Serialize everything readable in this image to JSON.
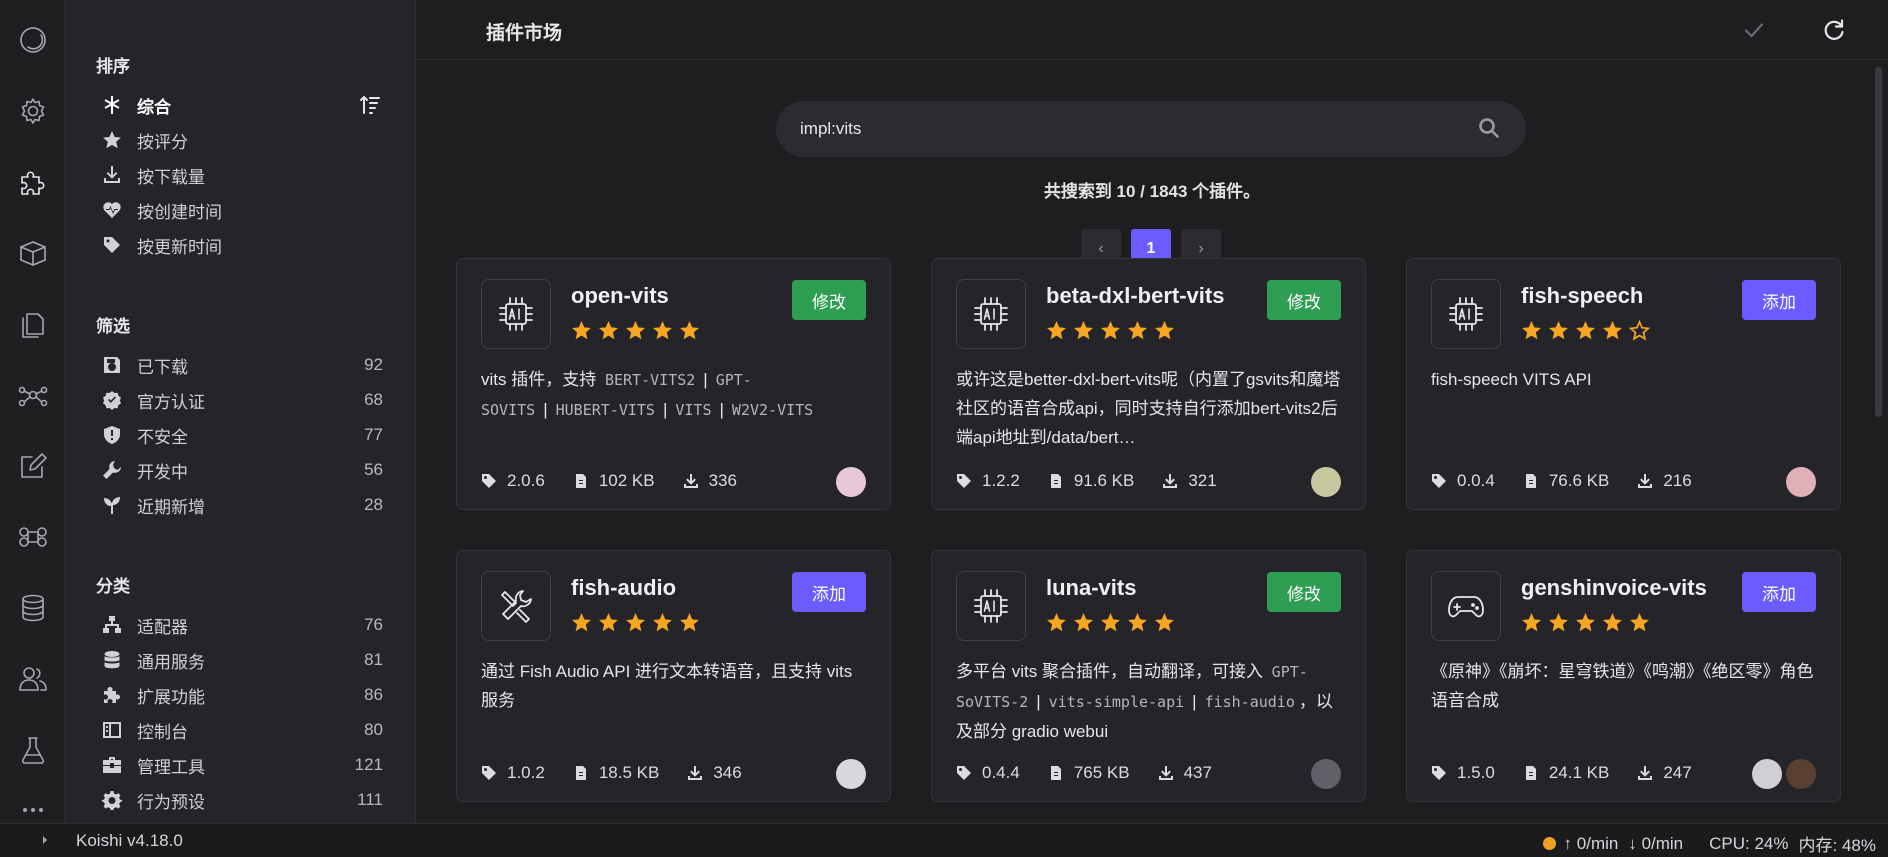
{
  "header": {
    "title": "插件市场"
  },
  "search": {
    "query": "impl:vits"
  },
  "results": {
    "summary": "共搜索到 10 / 1843 个插件。"
  },
  "pagination": {
    "prev": "‹",
    "current": "1",
    "next": "›"
  },
  "sidebar": {
    "sort_title": "排序",
    "sort": [
      {
        "label": "综合",
        "icon": "asterisk-icon",
        "active": true
      },
      {
        "label": "按评分",
        "icon": "star-icon"
      },
      {
        "label": "按下载量",
        "icon": "download-icon"
      },
      {
        "label": "按创建时间",
        "icon": "heartbeat-icon"
      },
      {
        "label": "按更新时间",
        "icon": "tag-icon"
      }
    ],
    "filter_title": "筛选",
    "filters": [
      {
        "label": "已下载",
        "count": "92",
        "icon": "save-icon"
      },
      {
        "label": "官方认证",
        "count": "68",
        "icon": "verified-icon"
      },
      {
        "label": "不安全",
        "count": "77",
        "icon": "shield-warning-icon"
      },
      {
        "label": "开发中",
        "count": "56",
        "icon": "wrench-icon"
      },
      {
        "label": "近期新增",
        "count": "28",
        "icon": "sprout-icon"
      }
    ],
    "category_title": "分类",
    "categories": [
      {
        "label": "适配器",
        "count": "76",
        "icon": "sitemap-icon"
      },
      {
        "label": "通用服务",
        "count": "81",
        "icon": "database-icon"
      },
      {
        "label": "扩展功能",
        "count": "86",
        "icon": "puzzle-icon"
      },
      {
        "label": "控制台",
        "count": "80",
        "icon": "console-icon"
      },
      {
        "label": "管理工具",
        "count": "121",
        "icon": "toolbox-icon"
      },
      {
        "label": "行为预设",
        "count": "111",
        "icon": "gear-icon"
      }
    ]
  },
  "plugins": [
    {
      "name": "open-vits",
      "action": "修改",
      "action_type": "modify",
      "rating": 5,
      "icon": "ai-chip-icon",
      "desc_parts": [
        {
          "t": "text",
          "v": "vits 插件，支持 "
        },
        {
          "t": "code",
          "v": "BERT-VITS2"
        },
        {
          "t": "sep",
          "v": "|"
        },
        {
          "t": "code",
          "v": "GPT-SOVITS"
        },
        {
          "t": "sep",
          "v": "|"
        },
        {
          "t": "code",
          "v": "HUBERT-VITS"
        },
        {
          "t": "sep",
          "v": "|"
        },
        {
          "t": "code",
          "v": "VITS"
        },
        {
          "t": "sep",
          "v": "|"
        },
        {
          "t": "code",
          "v": "W2V2-VITS"
        }
      ],
      "version": "2.0.6",
      "size": "102 KB",
      "downloads": "336",
      "avatars": [
        "#e8c8d8"
      ]
    },
    {
      "name": "beta-dxl-bert-vits",
      "action": "修改",
      "action_type": "modify",
      "rating": 5,
      "icon": "ai-chip-icon",
      "desc_parts": [
        {
          "t": "text",
          "v": "或许这是better-dxl-bert-vits呢（内置了gsvits和魔塔社区的语音合成api，同时支持自行添加bert-vits2后端api地址到/data/bert…"
        }
      ],
      "version": "1.2.2",
      "size": "91.6 KB",
      "downloads": "321",
      "avatars": [
        "#c8c8a0"
      ]
    },
    {
      "name": "fish-speech",
      "action": "添加",
      "action_type": "add",
      "rating": 4,
      "icon": "ai-chip-icon",
      "desc_parts": [
        {
          "t": "text",
          "v": "fish-speech VITS API"
        }
      ],
      "version": "0.0.4",
      "size": "76.6 KB",
      "downloads": "216",
      "avatars": [
        "#e0b0b8"
      ]
    },
    {
      "name": "fish-audio",
      "action": "添加",
      "action_type": "add",
      "rating": 5,
      "icon": "tools-icon",
      "desc_parts": [
        {
          "t": "text",
          "v": "通过 Fish Audio API 进行文本转语音，且支持 vits 服务"
        }
      ],
      "version": "1.0.2",
      "size": "18.5 KB",
      "downloads": "346",
      "avatars": [
        "#d8d8dc"
      ]
    },
    {
      "name": "luna-vits",
      "action": "修改",
      "action_type": "modify",
      "rating": 5,
      "icon": "ai-chip-icon",
      "desc_parts": [
        {
          "t": "text",
          "v": "多平台 vits 聚合插件，自动翻译，可接入 "
        },
        {
          "t": "code",
          "v": "GPT-SoVITS-2"
        },
        {
          "t": "sep",
          "v": "|"
        },
        {
          "t": "code",
          "v": "vits-simple-api"
        },
        {
          "t": "sep",
          "v": "|"
        },
        {
          "t": "code",
          "v": "fish-audio"
        },
        {
          "t": "text",
          "v": "，以及部分 gradio webui"
        }
      ],
      "version": "0.4.4",
      "size": "765 KB",
      "downloads": "437",
      "avatars": [
        "#606068"
      ]
    },
    {
      "name": "genshinvoice-vits",
      "action": "添加",
      "action_type": "add",
      "rating": 5,
      "icon": "gamepad-icon",
      "desc_parts": [
        {
          "t": "text",
          "v": "《原神》《崩坏：星穹铁道》《鸣潮》《绝区零》角色语音合成"
        }
      ],
      "version": "1.5.0",
      "size": "24.1 KB",
      "downloads": "247",
      "avatars": [
        "#d0d0d4",
        "#5a4030"
      ]
    }
  ],
  "statusbar": {
    "version": "Koishi v4.18.0",
    "up": "↑ 0/min",
    "down": "↓ 0/min",
    "cpu": "CPU: 24%",
    "mem": "内存: 48%"
  },
  "colors": {
    "accent": "#6b5cff",
    "modify": "#2e9e52",
    "star": "#f5a623",
    "status_dot": "#f0a020"
  }
}
